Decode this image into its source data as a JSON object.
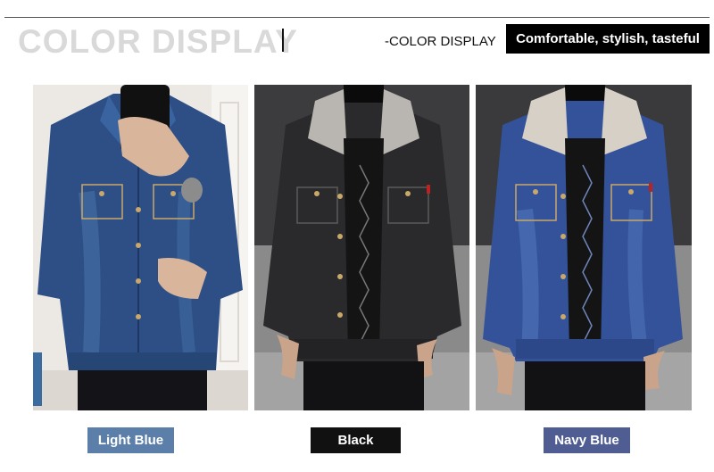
{
  "header": {
    "title": "COLOR DISPLAY",
    "subtitle": "-COLOR DISPLAY",
    "tagline": "Comfortable, stylish, tasteful"
  },
  "variants": [
    {
      "label": "Light Blue",
      "label_color": "#5b7fa8",
      "jacket_color": "#2d4f86"
    },
    {
      "label": "Black",
      "label_color": "#111111",
      "jacket_color": "#2a2a2c"
    },
    {
      "label": "Navy Blue",
      "label_color": "#4f5d92",
      "jacket_color": "#34529a"
    }
  ]
}
